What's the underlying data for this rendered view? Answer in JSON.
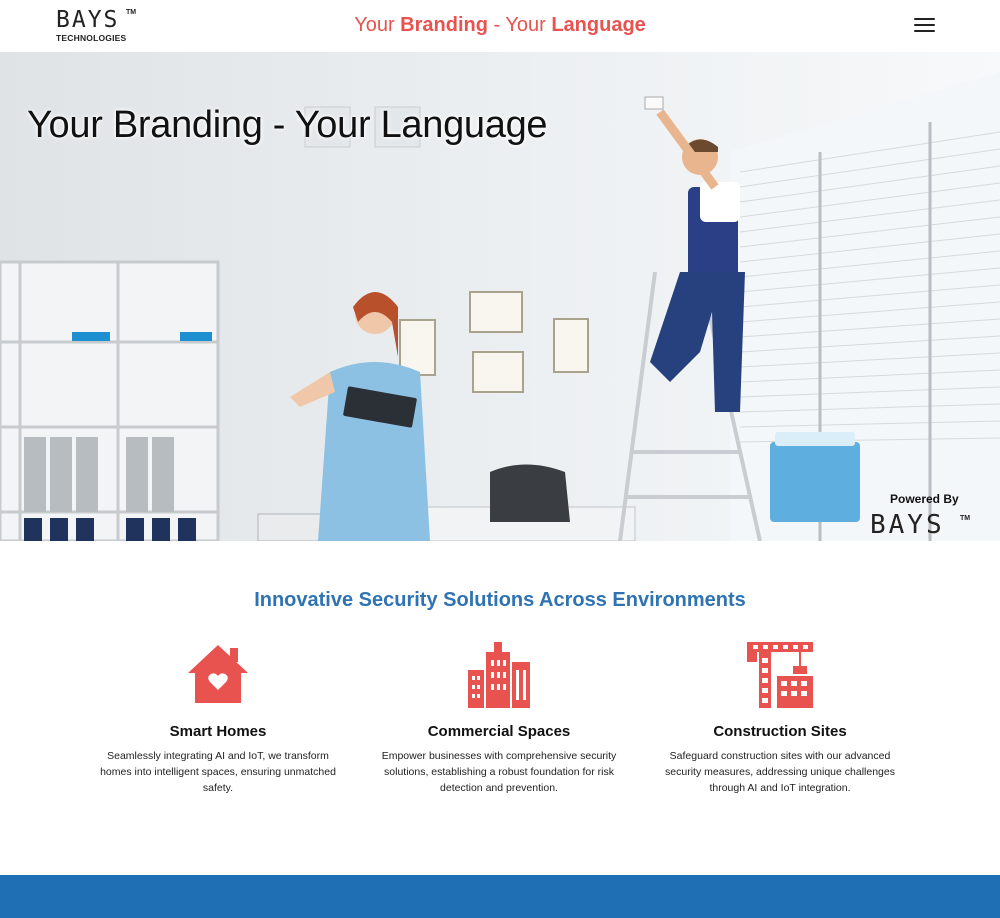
{
  "header": {
    "logo_text": "BAYS",
    "logo_tm": "TM",
    "logo_sub": "TECHNOLOGIES",
    "title_part1": "Your ",
    "title_part2": "Branding",
    "title_part3": " - Your ",
    "title_part4": "Language",
    "menu_icon": "hamburger-menu-icon"
  },
  "hero": {
    "title": "Your Branding - Your Language",
    "powered_by": "Powered By",
    "powered_logo": "BAYS",
    "powered_tm": "TM"
  },
  "features": {
    "section_title": "Innovative Security Solutions Across Environments",
    "items": [
      {
        "icon": "smart-home-icon",
        "title": "Smart Homes",
        "description": "Seamlessly integrating AI and IoT, we transform homes into intelligent spaces, ensuring unmatched safety."
      },
      {
        "icon": "commercial-building-icon",
        "title": "Commercial Spaces",
        "description": "Empower businesses with comprehensive security solutions, establishing a robust foundation for risk detection and prevention."
      },
      {
        "icon": "construction-crane-icon",
        "title": "Construction Sites",
        "description": "Safeguard construction sites with our advanced security measures, addressing unique challenges through AI and IoT integration."
      }
    ]
  },
  "colors": {
    "accent_red": "#e8524f",
    "accent_blue": "#2f73b2",
    "footer_blue": "#1e6fb3"
  }
}
